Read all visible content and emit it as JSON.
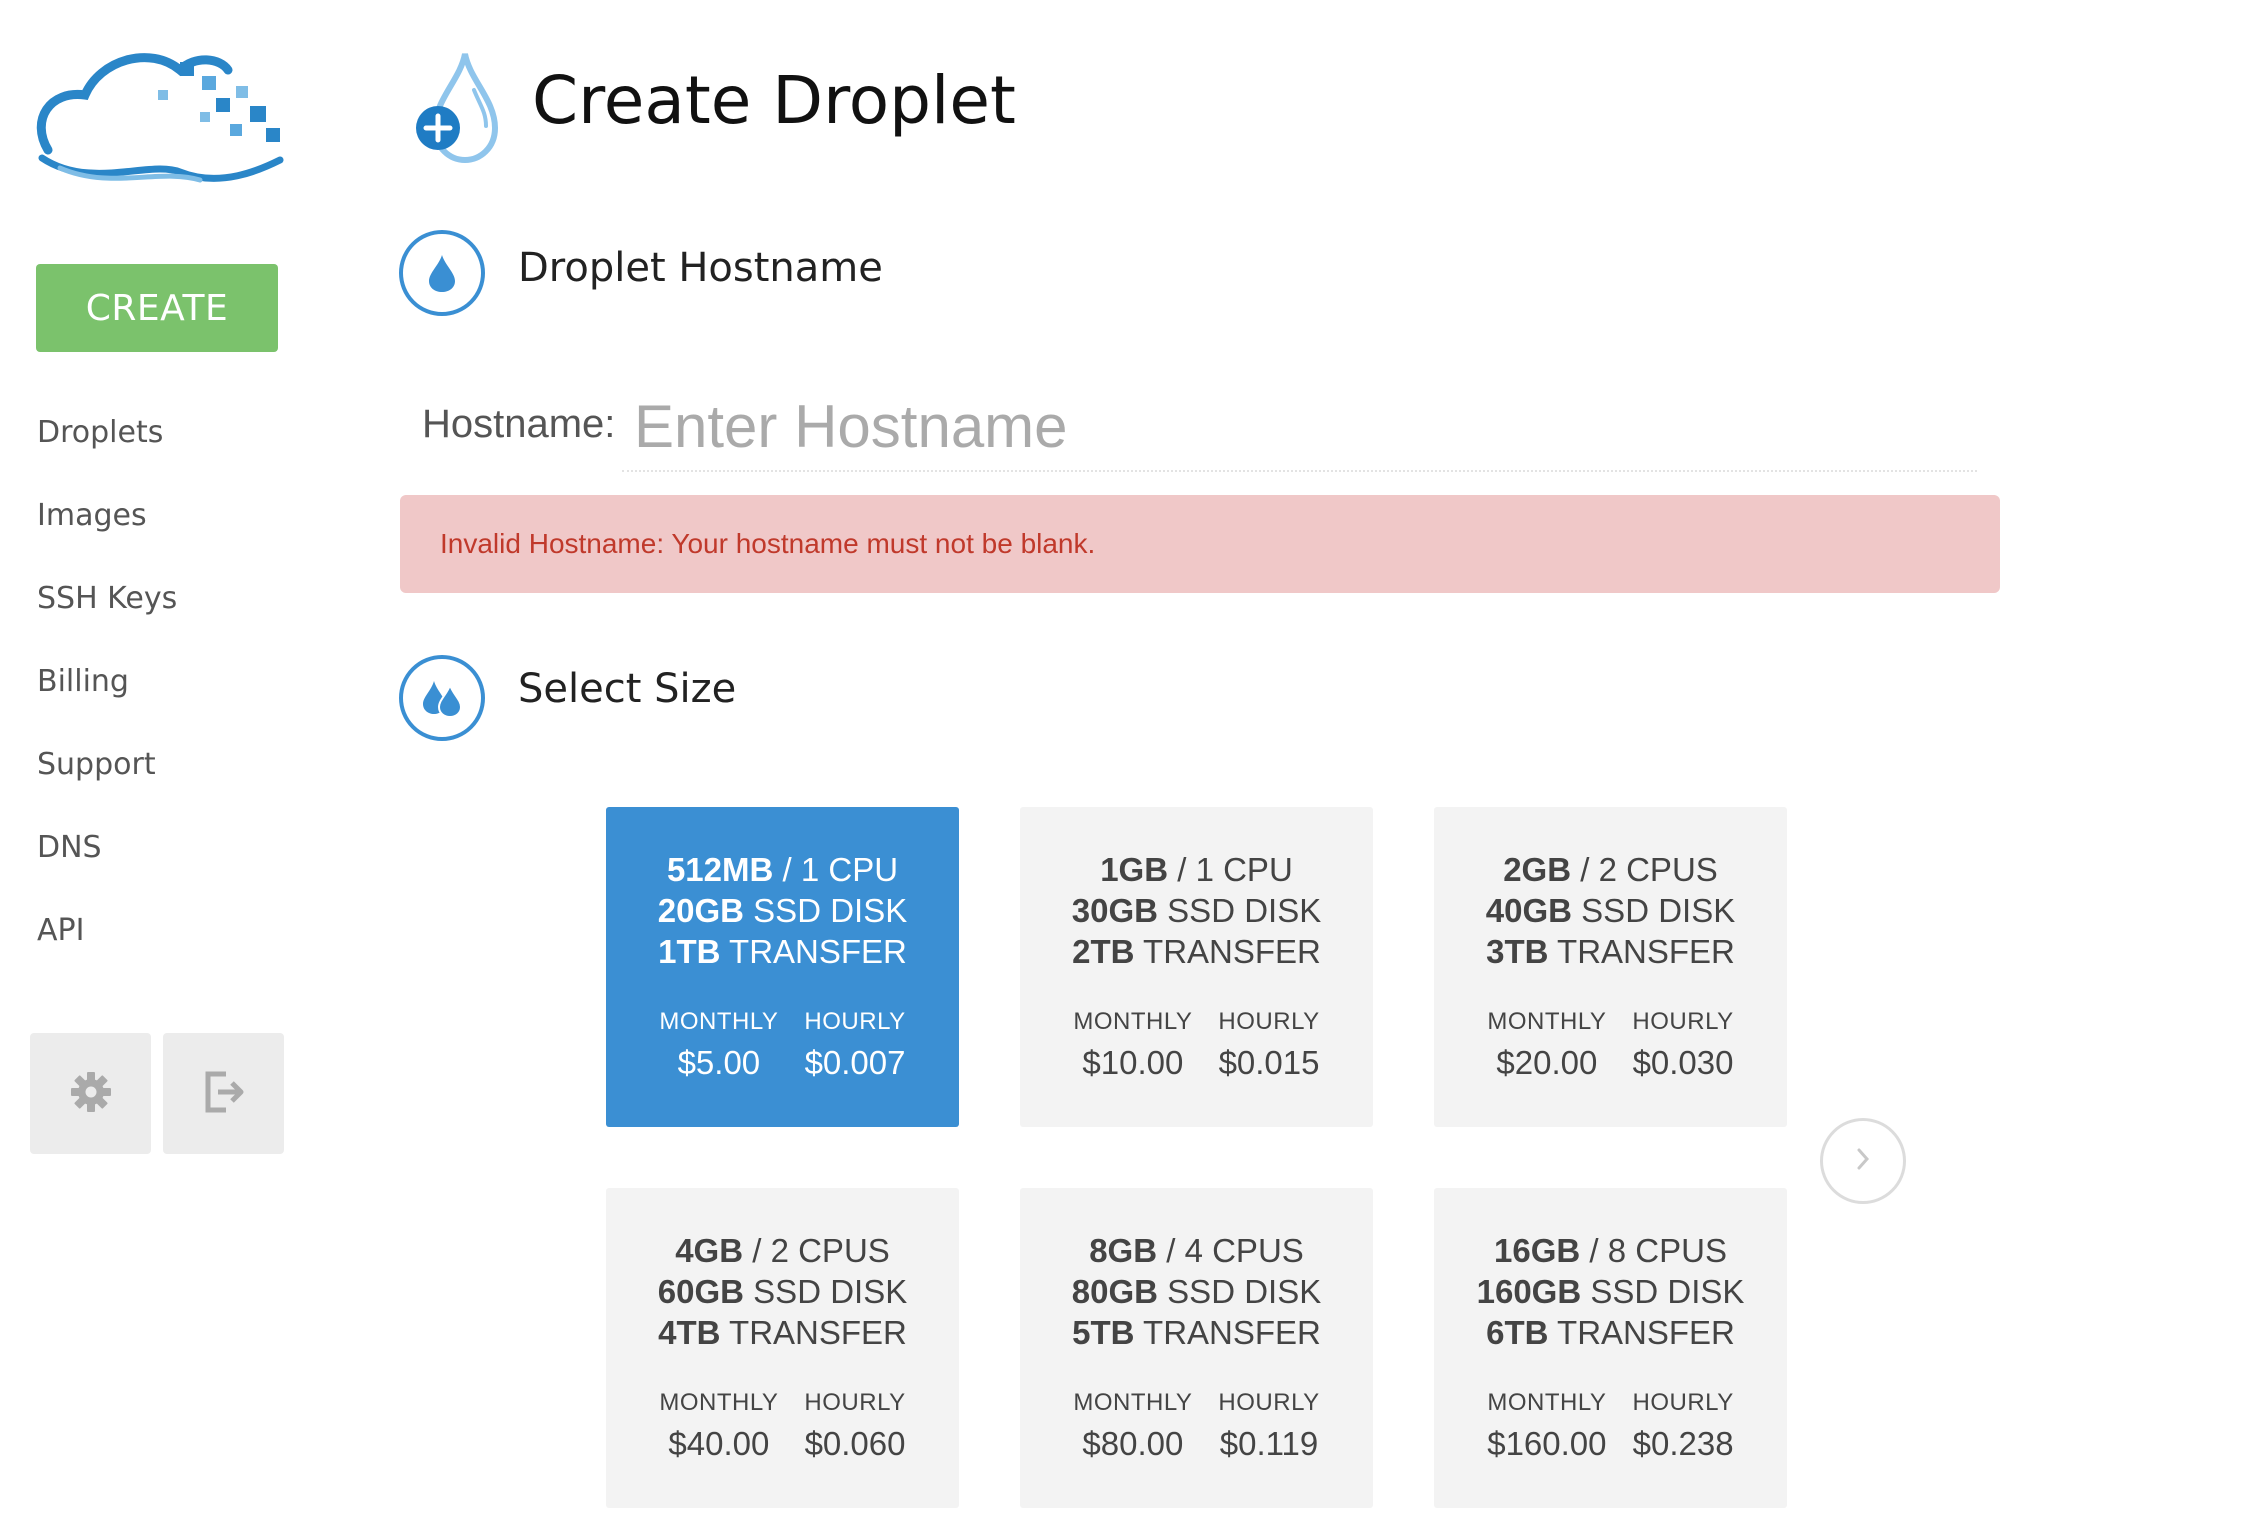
{
  "sidebar": {
    "create_label": "CREATE",
    "nav_items": [
      {
        "label": "Droplets"
      },
      {
        "label": "Images"
      },
      {
        "label": "SSH Keys"
      },
      {
        "label": "Billing"
      },
      {
        "label": "Support"
      },
      {
        "label": "DNS"
      },
      {
        "label": "API"
      }
    ],
    "settings_icon": "gear-icon",
    "logout_icon": "logout-icon"
  },
  "page": {
    "title": "Create Droplet"
  },
  "sections": {
    "hostname": {
      "title": "Droplet Hostname",
      "label": "Hostname:",
      "placeholder": "Enter Hostname",
      "value": "",
      "error": "Invalid Hostname: Your hostname must not be blank."
    },
    "size": {
      "title": "Select Size"
    }
  },
  "sizes": [
    {
      "memory": "512MB",
      "cpu": "1 CPU",
      "disk": "20GB",
      "disk_label": "SSD DISK",
      "transfer": "1TB",
      "transfer_label": "TRANSFER",
      "monthly_label": "MONTHLY",
      "hourly_label": "HOURLY",
      "monthly": "$5.00",
      "hourly": "$0.007",
      "selected": true
    },
    {
      "memory": "1GB",
      "cpu": "1 CPU",
      "disk": "30GB",
      "disk_label": "SSD DISK",
      "transfer": "2TB",
      "transfer_label": "TRANSFER",
      "monthly_label": "MONTHLY",
      "hourly_label": "HOURLY",
      "monthly": "$10.00",
      "hourly": "$0.015",
      "selected": false
    },
    {
      "memory": "2GB",
      "cpu": "2 CPUS",
      "disk": "40GB",
      "disk_label": "SSD DISK",
      "transfer": "3TB",
      "transfer_label": "TRANSFER",
      "monthly_label": "MONTHLY",
      "hourly_label": "HOURLY",
      "monthly": "$20.00",
      "hourly": "$0.030",
      "selected": false
    },
    {
      "memory": "4GB",
      "cpu": "2 CPUS",
      "disk": "60GB",
      "disk_label": "SSD DISK",
      "transfer": "4TB",
      "transfer_label": "TRANSFER",
      "monthly_label": "MONTHLY",
      "hourly_label": "HOURLY",
      "monthly": "$40.00",
      "hourly": "$0.060",
      "selected": false
    },
    {
      "memory": "8GB",
      "cpu": "4 CPUS",
      "disk": "80GB",
      "disk_label": "SSD DISK",
      "transfer": "5TB",
      "transfer_label": "TRANSFER",
      "monthly_label": "MONTHLY",
      "hourly_label": "HOURLY",
      "monthly": "$80.00",
      "hourly": "$0.119",
      "selected": false
    },
    {
      "memory": "16GB",
      "cpu": "8 CPUS",
      "disk": "160GB",
      "disk_label": "SSD DISK",
      "transfer": "6TB",
      "transfer_label": "TRANSFER",
      "monthly_label": "MONTHLY",
      "hourly_label": "HOURLY",
      "monthly": "$160.00",
      "hourly": "$0.238",
      "selected": false
    }
  ],
  "colors": {
    "accent_blue": "#3b8fd3",
    "create_green": "#7bc26c",
    "error_bg": "#f0c8c8",
    "error_text": "#c0392b",
    "card_bg": "#f3f3f3"
  }
}
